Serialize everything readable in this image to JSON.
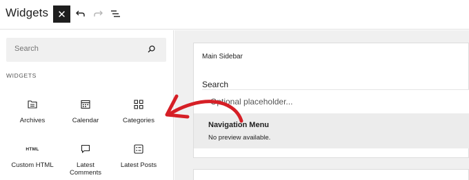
{
  "header": {
    "title": "Widgets",
    "close_icon": "close-icon",
    "undo_icon": "undo-icon",
    "redo_icon": "redo-icon",
    "list_view_icon": "list-view-icon"
  },
  "sidebar": {
    "search_placeholder": "Search",
    "section_label": "WIDGETS",
    "blocks": [
      {
        "label": "Archives",
        "icon": "archive-icon"
      },
      {
        "label": "Calendar",
        "icon": "calendar-icon"
      },
      {
        "label": "Categories",
        "icon": "categories-icon"
      },
      {
        "label": "Custom HTML",
        "icon": "html-icon",
        "icon_text": "HTML"
      },
      {
        "label": "Latest Comments",
        "icon": "comment-icon"
      },
      {
        "label": "Latest Posts",
        "icon": "posts-list-icon"
      }
    ]
  },
  "canvas": {
    "area_title": "Main Sidebar",
    "search_widget": {
      "label": "Search",
      "placeholder": "Optional placeholder..."
    },
    "nav_menu": {
      "title": "Navigation Menu",
      "subtitle": "No preview available."
    }
  },
  "colors": {
    "dark": "#1e1e1e",
    "annotation_arrow": "#d61f26",
    "canvas_bg": "#f0f0f0"
  }
}
